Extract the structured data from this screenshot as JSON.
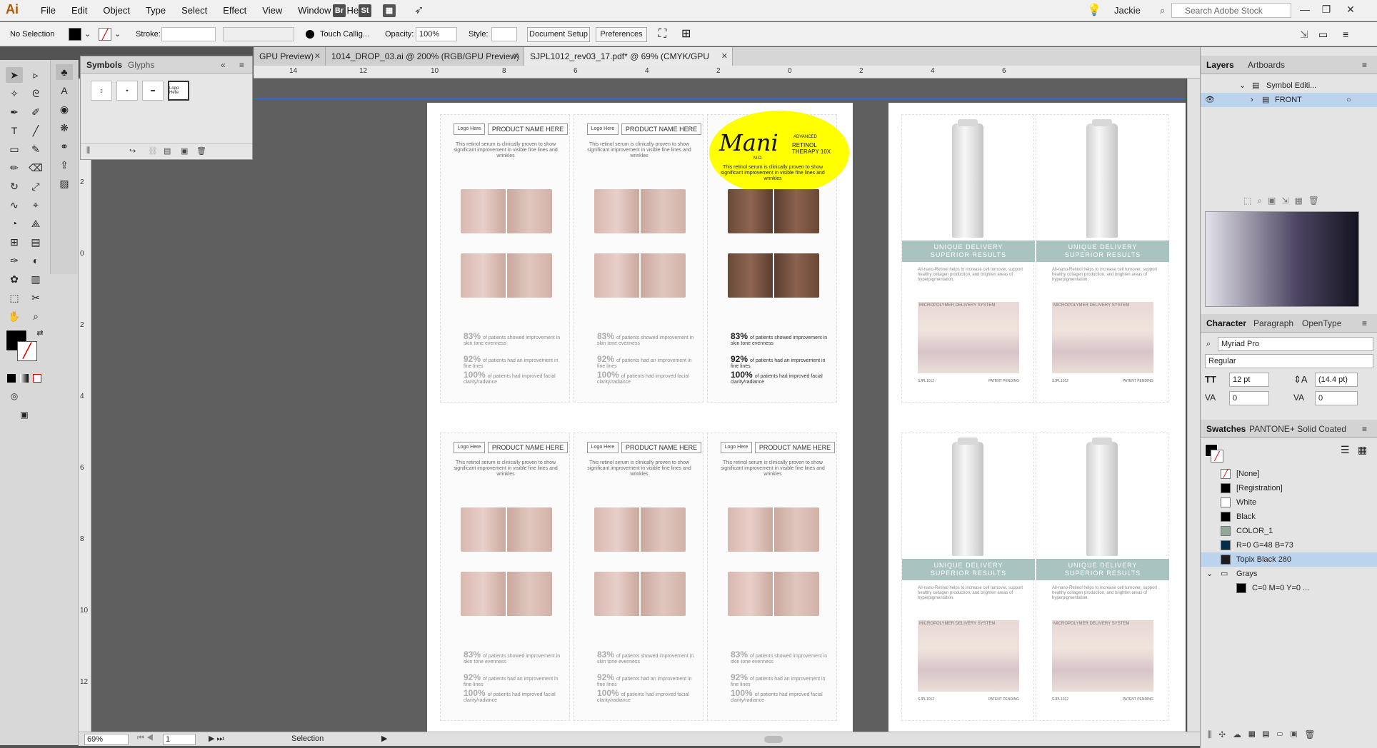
{
  "app": {
    "logo": "Ai"
  },
  "menu": [
    "File",
    "Edit",
    "Object",
    "Type",
    "Select",
    "Effect",
    "View",
    "Window",
    "Help"
  ],
  "menu_icons": {
    "br": "Br",
    "st": "St"
  },
  "user": "Jackie",
  "search": {
    "placeholder": "Search Adobe Stock"
  },
  "control": {
    "selection": "No Selection",
    "stroke_label": "Stroke:",
    "brush": "Touch Callig...",
    "opacity_label": "Opacity:",
    "opacity_value": "100%",
    "style_label": "Style:",
    "doc_setup": "Document Setup",
    "preferences": "Preferences"
  },
  "tabs": [
    {
      "label": "GPU Preview)",
      "close": "✕"
    },
    {
      "label": "1014_DROP_03.ai @ 200% (RGB/GPU Preview)",
      "close": "✕"
    },
    {
      "label": "SJPL1012_rev03_17.pdf* @ 69% (CMYK/GPU Preview)",
      "close": "✕"
    }
  ],
  "ruler_top": [
    "14",
    "12",
    "10",
    "8",
    "6",
    "4",
    "2",
    "0",
    "2",
    "4",
    "6"
  ],
  "ruler_left": [
    "2",
    "0",
    "2",
    "4",
    "6",
    "8",
    "10",
    "12"
  ],
  "symbols_panel": {
    "tab1": "Symbols",
    "tab2": "Glyphs",
    "sym4": "Logo Here"
  },
  "cards": {
    "logo": "Logo Here",
    "product": "PRODUCT NAME HERE",
    "desc": "This retinol serum is clinically proven to show significant improvement in visible fine lines and wrinkles",
    "stat1_pct": "83%",
    "stat1_txt": "of patients showed improvement in skin tone evenness",
    "stat2_pct": "92%",
    "stat2_txt": "of patients had an improvement in fine lines",
    "stat3_pct": "100%",
    "stat3_txt": "of patients had improved facial clarity/radiance"
  },
  "featured": {
    "brand": "Mani",
    "sub": "M.D.",
    "tag": "ADVANCED",
    "title": "RETINOL THERAPY 10X"
  },
  "back": {
    "headline1": "UNIQUE DELIVERY",
    "headline2": "SUPERIOR RESULTS",
    "body": "All-nano-Retinol helps to increase cell turnover, support healthy collagen production, and brighten areas of hyperpigmentation.",
    "img_label": "MICROPOLYMER DELIVERY SYSTEM",
    "footer_left": "SJPL1012",
    "footer_right": "PATENT PENDING"
  },
  "status": {
    "zoom": "69%",
    "page": "1",
    "mode": "Selection"
  },
  "layers_panel": {
    "tab1": "Layers",
    "tab2": "Artboards",
    "row1": "Symbol Editi...",
    "row2": "FRONT"
  },
  "character": {
    "tab1": "Character",
    "tab2": "Paragraph",
    "tab3": "OpenType",
    "font": "Myriad Pro",
    "style": "Regular",
    "size": "12 pt",
    "leading": "(14.4 pt)",
    "kerning": "0",
    "tracking": "0"
  },
  "swatches": {
    "tab1": "Swatches",
    "tab2": "PANTONE+ Solid Coated",
    "items": [
      "[None]",
      "[Registration]",
      "White",
      "Black",
      "COLOR_1",
      "R=0 G=48 B=73",
      "Topix Black 280",
      "Grays",
      "C=0 M=0 Y=0 ..."
    ]
  },
  "colors": {
    "accent": "#ffff00",
    "teal": "#a8c3c0",
    "selection": "#bcd3ee"
  }
}
